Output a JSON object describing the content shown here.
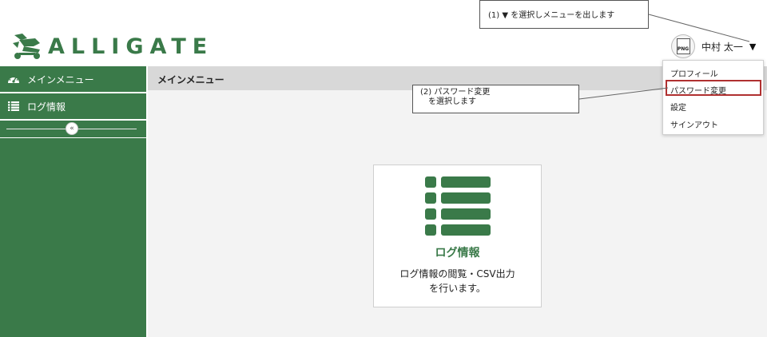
{
  "header": {
    "logo_text": "ALLIGATE",
    "avatar_label": "PNG",
    "user_name": "中村 太一",
    "caret": "▼"
  },
  "sidebar": {
    "items": [
      {
        "label": "メインメニュー",
        "icon": "dashboard-icon"
      },
      {
        "label": "ログ情報",
        "icon": "list-icon"
      }
    ],
    "collapse_glyph": "«"
  },
  "main": {
    "title": "メインメニュー",
    "card": {
      "icon": "list-icon",
      "title": "ログ情報",
      "description": "ログ情報の閲覧・CSV出力\nを行います。"
    }
  },
  "dropdown": {
    "items": [
      "プロフィール",
      "パスワード変更",
      "設定",
      "サインアウト"
    ],
    "highlighted": "パスワード変更"
  },
  "callouts": {
    "step1": "(1) ▼ を選択しメニューを出します",
    "step2_line1": "(2) パスワード変更",
    "step2_line2": "を選択します"
  },
  "colors": {
    "brand_green": "#3a7a49",
    "highlight_red": "#b03030",
    "header_bar_gray": "#d8d8d8",
    "content_bg": "#f3f3f3"
  }
}
